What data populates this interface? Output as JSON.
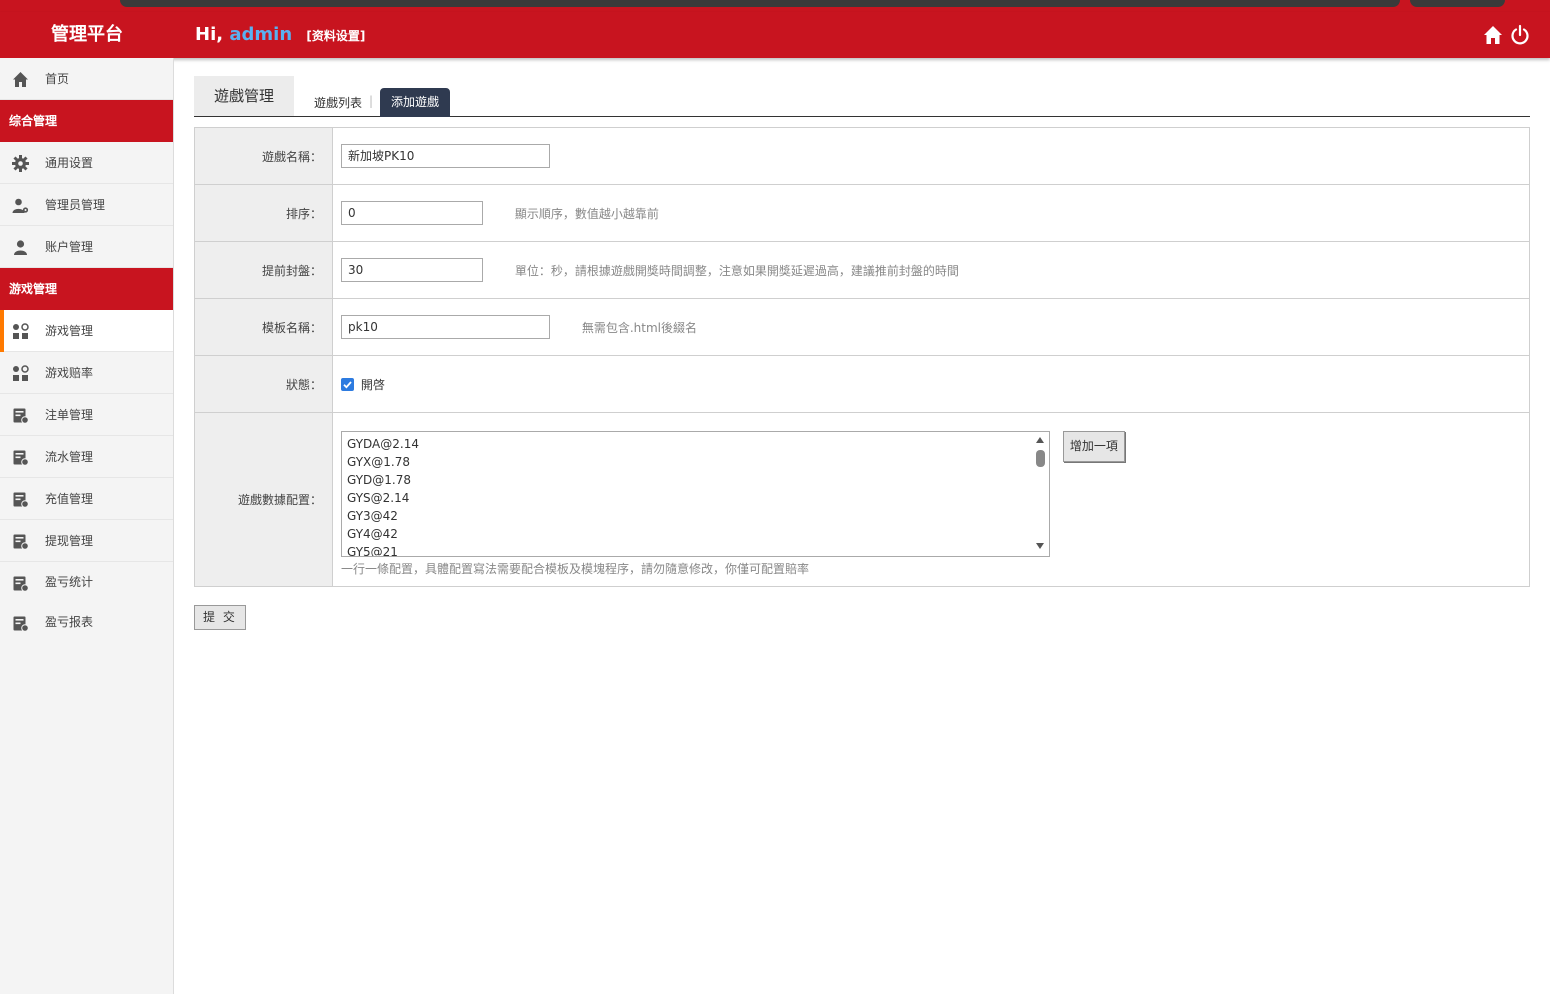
{
  "header": {
    "brand": "管理平台",
    "greeting": "Hi,",
    "username": "admin",
    "settings_link": "[资料设置]",
    "home_icon": "home-icon",
    "power_icon": "power-icon"
  },
  "sidebar": {
    "home": "首页",
    "section1": "综合管理",
    "general_settings": "通用设置",
    "admin_management": "管理员管理",
    "account_management": "账户管理",
    "section2": "游戏管理",
    "game_management": "游戏管理",
    "game_odds": "游戏赔率",
    "bet_management": "注单管理",
    "flow_management": "流水管理",
    "recharge_management": "充值管理",
    "withdraw_management": "提现管理",
    "profit_stats": "盈亏统计",
    "profit_report": "盈亏报表"
  },
  "tabs": {
    "main": "遊戲管理",
    "list": "遊戲列表",
    "separator": "|",
    "add": "添加遊戲"
  },
  "form": {
    "name_label": "遊戲名稱：",
    "name_value": "新加坡PK10",
    "sort_label": "排序：",
    "sort_value": "0",
    "sort_hint": "顯示順序，數值越小越靠前",
    "close_label": "提前封盤：",
    "close_value": "30",
    "close_hint": "單位：秒，請根據遊戲開獎時間調整，注意如果開獎延遲過高，建議推前封盤的時間",
    "template_label": "模板名稱：",
    "template_value": "pk10",
    "template_hint": "無需包含.html後綴名",
    "status_label": "狀態：",
    "status_option": "開啓",
    "status_checked": true,
    "config_label": "遊戲數據配置：",
    "config_lines": [
      "GYDA@2.14",
      "GYX@1.78",
      "GYD@1.78",
      "GYS@2.14",
      "GY3@42",
      "GY4@42",
      "GY5@21"
    ],
    "add_item": "增加一項",
    "config_hint": "一行一條配置，具體配置寫法需要配合模板及模塊程序，請勿隨意修改，你僅可配置賠率"
  },
  "submit": "提 交",
  "colors": {
    "brand_red": "#c8141f",
    "active_tab": "#2f3a50",
    "active_marker": "#ff7a00",
    "username": "#5ab0f0"
  }
}
